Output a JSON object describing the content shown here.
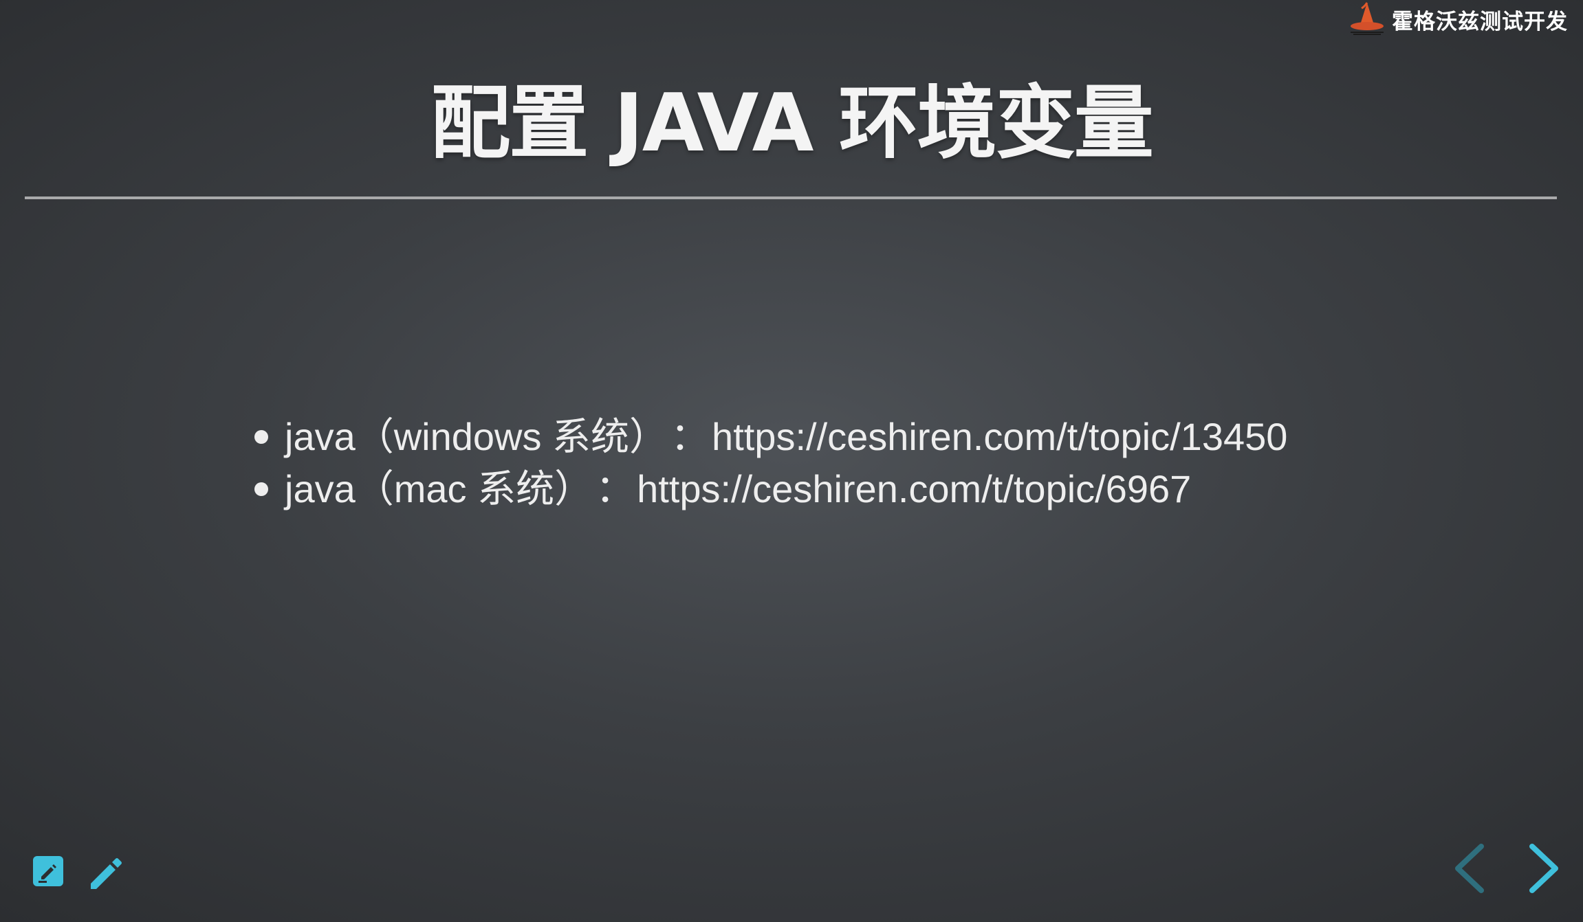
{
  "brand": {
    "name": "霍格沃兹测试开发",
    "logo_icon": "wizard-hat-icon"
  },
  "slide": {
    "title": "配置 JAVA 环境变量",
    "bullets": [
      {
        "label": "java（windows 系统）",
        "separator": "：",
        "url": "https://ceshiren.com/t/topic/13450"
      },
      {
        "label": "java（mac 系统）",
        "separator": "：",
        "url": "https://ceshiren.com/t/topic/6967"
      }
    ]
  },
  "controls": {
    "left": [
      {
        "name": "notes-edit-icon"
      },
      {
        "name": "pencil-icon"
      }
    ],
    "navigation": {
      "prev_icon": "chevron-left-icon",
      "next_icon": "chevron-right-icon"
    }
  },
  "colors": {
    "accent": "#3fc0dc",
    "nav_disabled": "#2f6f7e",
    "title_text": "#f4f4f4",
    "body_text": "#eeeeee",
    "divider": "#a9aaab",
    "logo": "#e05a2b"
  }
}
